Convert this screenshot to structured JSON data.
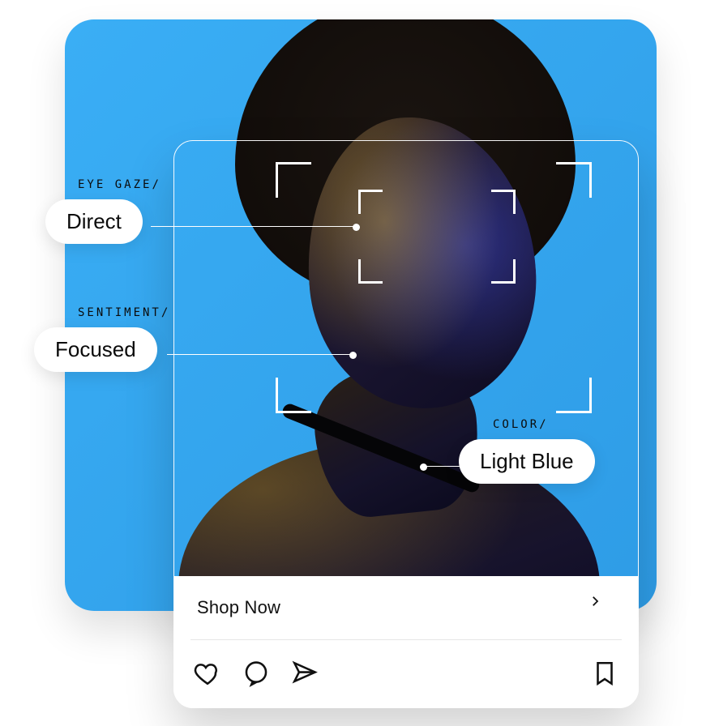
{
  "colors": {
    "background_blue": "#2e9ce6",
    "accent_blue_light": "#3aaef5",
    "white": "#ffffff",
    "text": "#0b0b0b"
  },
  "annotations": {
    "eye_gaze": {
      "heading": "EYE GAZE",
      "slash": "/",
      "value": "Direct"
    },
    "sentiment": {
      "heading": "SENTIMENT",
      "slash": "/",
      "value": "Focused"
    },
    "color": {
      "heading": "COLOR",
      "slash": "/",
      "value": "Light Blue"
    }
  },
  "card": {
    "cta_label": "Shop Now",
    "icons": {
      "like": "heart-icon",
      "comment": "comment-icon",
      "share": "paper-plane-icon",
      "bookmark": "bookmark-icon",
      "chevron": "chevron-right-icon"
    }
  }
}
